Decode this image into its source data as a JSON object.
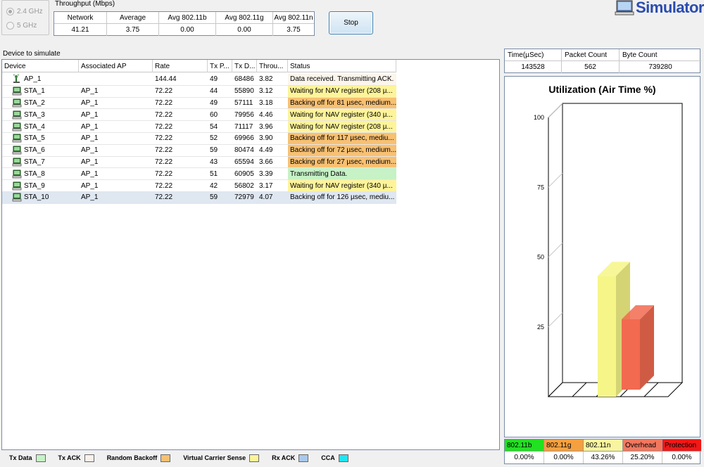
{
  "band": {
    "options": [
      {
        "label": "2.4 GHz",
        "checked": true
      },
      {
        "label": "5 GHz",
        "checked": false
      }
    ]
  },
  "throughput": {
    "caption": "Throughput (Mbps)",
    "headers": [
      "Network",
      "Average",
      "Avg 802.11b",
      "Avg 802.11g",
      "Avg 802.11n"
    ],
    "values": [
      "41.21",
      "3.75",
      "0.00",
      "0.00",
      "3.75"
    ]
  },
  "controls": {
    "stop_label": "Stop"
  },
  "app": {
    "title": "Simulator"
  },
  "devices": {
    "caption": "Device to simulate",
    "headers": [
      "Device",
      "Associated AP",
      "Rate",
      "Tx P...",
      "Tx D...",
      "Throu...",
      "Status"
    ],
    "rows": [
      {
        "device": "AP_1",
        "ap": "",
        "rate": "144.44",
        "txp": "49",
        "txd": "68486",
        "thr": "3.82",
        "status": "Data received. Transmitting ACK.",
        "status_color": "blank",
        "kind": "ap"
      },
      {
        "device": "STA_1",
        "ap": "AP_1",
        "rate": "72.22",
        "txp": "44",
        "txd": "55890",
        "thr": "3.12",
        "status": "Waiting for NAV register (208 µ...",
        "status_color": "yellow",
        "kind": "sta"
      },
      {
        "device": "STA_2",
        "ap": "AP_1",
        "rate": "72.22",
        "txp": "49",
        "txd": "57111",
        "thr": "3.18",
        "status": "Backing off for 81 µsec, medium...",
        "status_color": "orange",
        "kind": "sta"
      },
      {
        "device": "STA_3",
        "ap": "AP_1",
        "rate": "72.22",
        "txp": "60",
        "txd": "79956",
        "thr": "4.46",
        "status": "Waiting for NAV register (340 µ...",
        "status_color": "yellow",
        "kind": "sta"
      },
      {
        "device": "STA_4",
        "ap": "AP_1",
        "rate": "72.22",
        "txp": "54",
        "txd": "71117",
        "thr": "3.96",
        "status": "Waiting for NAV register (208 µ...",
        "status_color": "yellow",
        "kind": "sta"
      },
      {
        "device": "STA_5",
        "ap": "AP_1",
        "rate": "72.22",
        "txp": "52",
        "txd": "69966",
        "thr": "3.90",
        "status": "Backing off for 117 µsec, mediu...",
        "status_color": "orange",
        "kind": "sta"
      },
      {
        "device": "STA_6",
        "ap": "AP_1",
        "rate": "72.22",
        "txp": "59",
        "txd": "80474",
        "thr": "4.49",
        "status": "Backing off for 72 µsec, medium...",
        "status_color": "orange",
        "kind": "sta"
      },
      {
        "device": "STA_7",
        "ap": "AP_1",
        "rate": "72.22",
        "txp": "43",
        "txd": "65594",
        "thr": "3.66",
        "status": "Backing off for 27 µsec, medium...",
        "status_color": "orange",
        "kind": "sta"
      },
      {
        "device": "STA_8",
        "ap": "AP_1",
        "rate": "72.22",
        "txp": "51",
        "txd": "60905",
        "thr": "3.39",
        "status": "Transmitting Data.",
        "status_color": "green",
        "kind": "sta"
      },
      {
        "device": "STA_9",
        "ap": "AP_1",
        "rate": "72.22",
        "txp": "42",
        "txd": "56802",
        "thr": "3.17",
        "status": "Waiting for NAV register (340 µ...",
        "status_color": "yellow",
        "kind": "sta"
      },
      {
        "device": "STA_10",
        "ap": "AP_1",
        "rate": "72.22",
        "txp": "59",
        "txd": "72979",
        "thr": "4.07",
        "status": "Backing off for 126 µsec, mediu...",
        "status_color": "none",
        "kind": "sta",
        "selected": true
      }
    ]
  },
  "legend": [
    {
      "label": "Tx Data",
      "color": "#c6f2c6"
    },
    {
      "label": "Tx ACK",
      "color": "#fbf0e8"
    },
    {
      "label": "Random Backoff",
      "color": "#f7c072"
    },
    {
      "label": "Virtual Carrier Sense",
      "color": "#fdf49a"
    },
    {
      "label": "Rx ACK",
      "color": "#a9c8ea"
    },
    {
      "label": "CCA",
      "color": "#22e4f0"
    }
  ],
  "stats": {
    "headers": [
      "Time(µSec)",
      "Packet Count",
      "Byte Count"
    ],
    "values": [
      "143528",
      "562",
      "739280"
    ]
  },
  "chart_data": {
    "type": "bar",
    "title": "Utilization (Air Time %)",
    "categories": [
      "802.11b",
      "802.11g",
      "802.11n",
      "Overhead",
      "Protection"
    ],
    "values": [
      0.0,
      0.0,
      43.26,
      25.2,
      0.0
    ],
    "colors": [
      "#f6f688",
      "#f6f688",
      "#f6f688",
      "#f26a50",
      "#f26a50"
    ],
    "yticks": [
      "25",
      "50",
      "75",
      "100"
    ],
    "ylim": [
      0,
      100
    ],
    "grid": false
  },
  "utilization": {
    "headers": [
      {
        "label": "802.11b",
        "color": "#22e022"
      },
      {
        "label": "802.11g",
        "color": "#f4a040"
      },
      {
        "label": "802.11n",
        "color": "#f8f4a0"
      },
      {
        "label": "Overhead",
        "color": "#f07860"
      },
      {
        "label": "Protection",
        "color": "#f01818"
      }
    ],
    "values": [
      "0.00%",
      "0.00%",
      "43.26%",
      "25.20%",
      "0.00%"
    ]
  }
}
